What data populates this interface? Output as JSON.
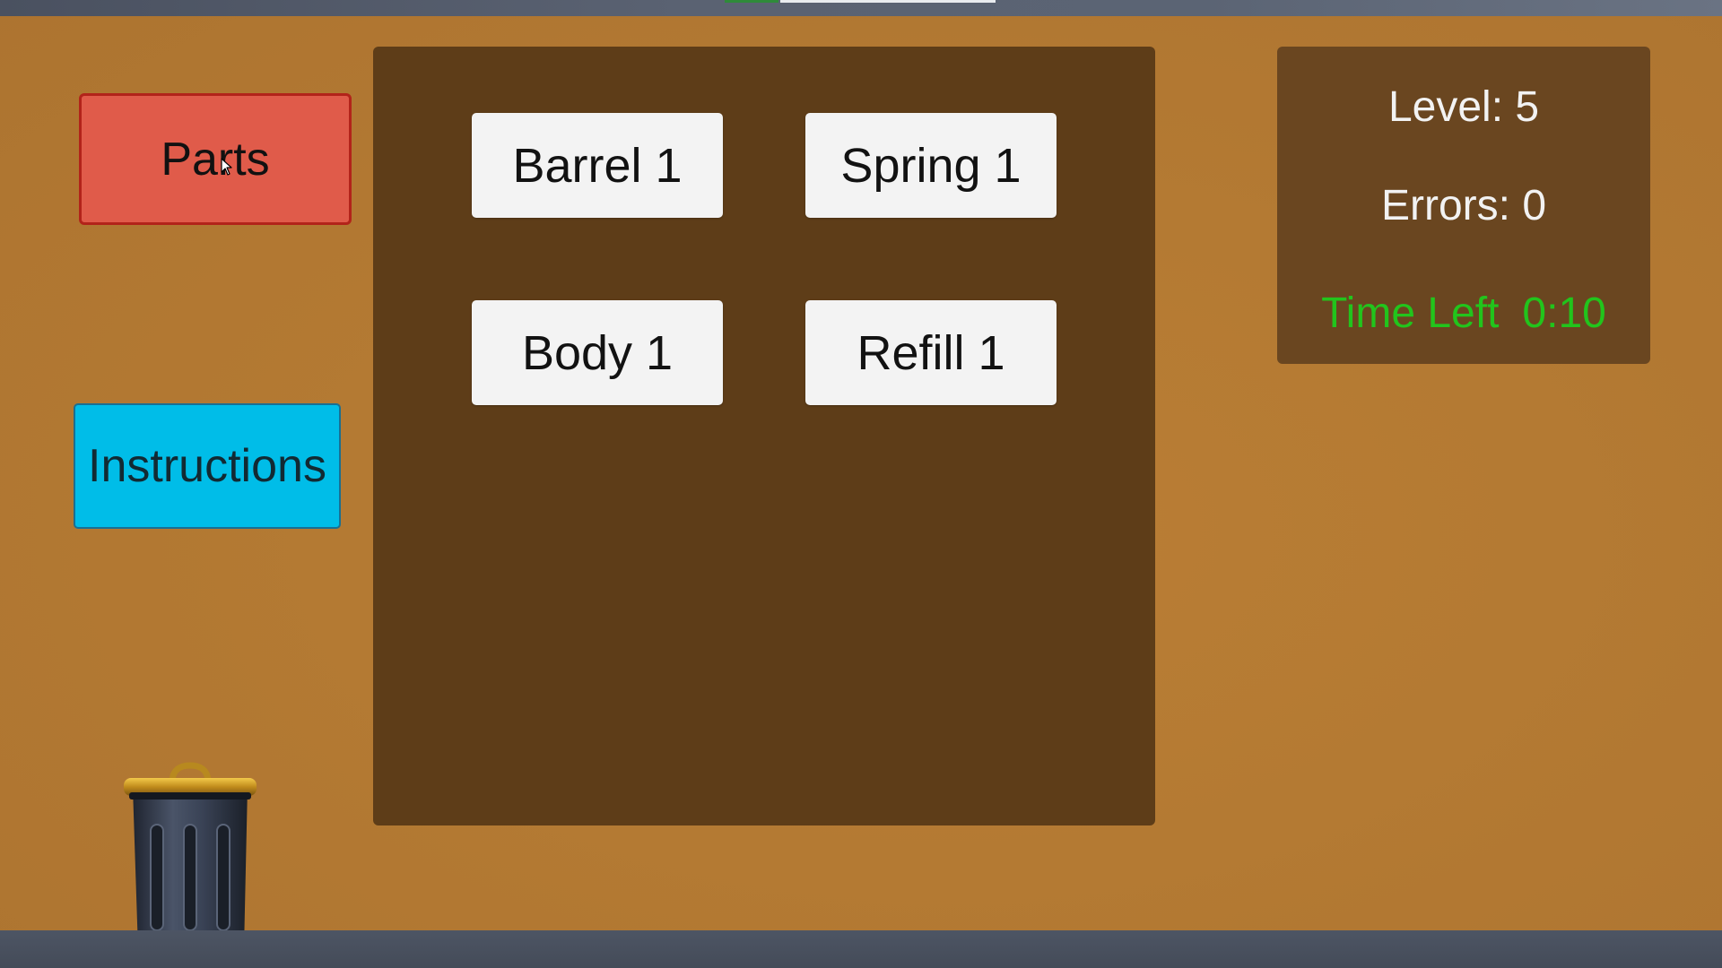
{
  "left_menu": {
    "parts_label": "Parts",
    "instructions_label": "Instructions"
  },
  "parts_panel": {
    "items": [
      {
        "label": "Barrel 1"
      },
      {
        "label": "Spring 1"
      },
      {
        "label": "Body 1"
      },
      {
        "label": "Refill 1"
      }
    ]
  },
  "stats": {
    "level": "Level: 5",
    "errors": "Errors: 0",
    "time_label": "Time Left",
    "time_value": "0:10"
  },
  "icons": {
    "trash": "trash-can-icon",
    "cursor": "mouse-cursor-icon"
  },
  "colors": {
    "background": "#b47a33",
    "parts_button": "#e05b4a",
    "instructions_button": "#00bde8",
    "panel": "#5e3d18",
    "stats_panel": "#6a4620",
    "timer": "#22c41c"
  }
}
